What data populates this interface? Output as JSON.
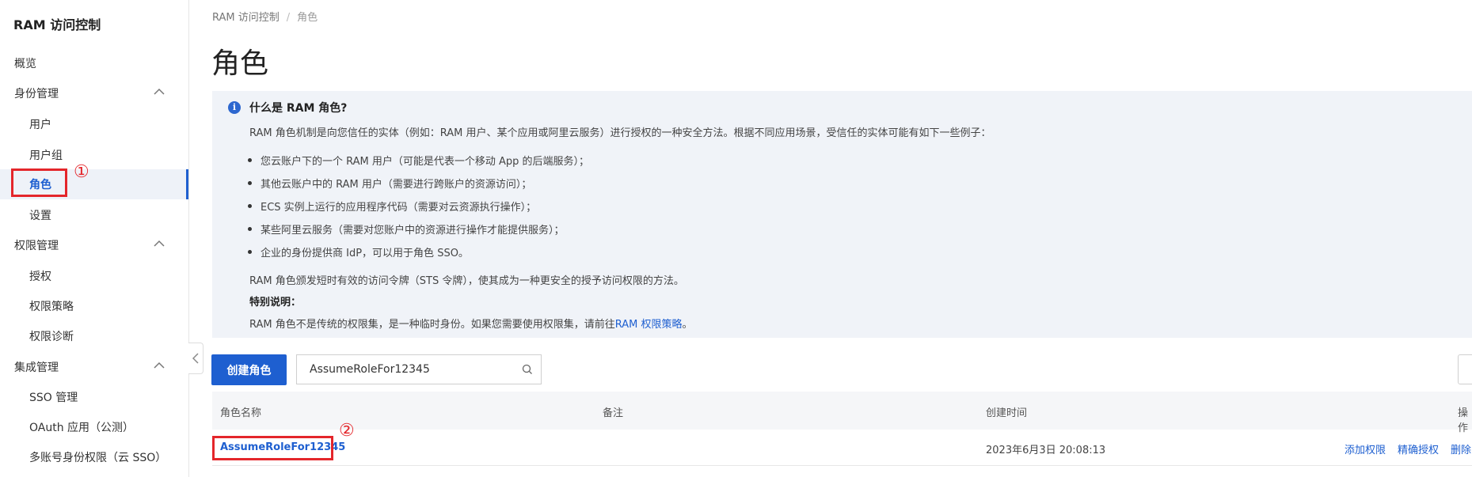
{
  "sidebar": {
    "app_title": "RAM 访问控制",
    "items": [
      {
        "label": "概览"
      },
      {
        "label": "身份管理"
      },
      {
        "label": "用户"
      },
      {
        "label": "用户组"
      },
      {
        "label": "角色"
      },
      {
        "label": "设置"
      },
      {
        "label": "权限管理"
      },
      {
        "label": "授权"
      },
      {
        "label": "权限策略"
      },
      {
        "label": "权限诊断"
      },
      {
        "label": "集成管理"
      },
      {
        "label": "SSO 管理"
      },
      {
        "label": "OAuth 应用（公测）"
      },
      {
        "label": "多账号身份权限（云 SSO）"
      }
    ]
  },
  "annotations": {
    "marker_1": "①",
    "marker_2": "②"
  },
  "breadcrumb": {
    "root": "RAM 访问控制",
    "separator": "/",
    "current": "角色"
  },
  "page_title": "角色",
  "info": {
    "title": "什么是 RAM 角色?",
    "intro": "RAM 角色机制是向您信任的实体（例如：RAM 用户、某个应用或阿里云服务）进行授权的一种安全方法。根据不同应用场景，受信任的实体可能有如下一些例子：",
    "bullets": [
      "您云账户下的一个 RAM 用户（可能是代表一个移动 App 的后端服务）；",
      "其他云账户中的 RAM 用户（需要进行跨账户的资源访问）；",
      "ECS 实例上运行的应用程序代码（需要对云资源执行操作）；",
      "某些阿里云服务（需要对您账户中的资源进行操作才能提供服务）；",
      "企业的身份提供商 IdP，可以用于角色 SSO。"
    ],
    "sts_note": "RAM 角色颁发短时有效的访问令牌（STS 令牌），使其成为一种更安全的授予访问权限的方法。",
    "special_title": "特别说明：",
    "special_text": "RAM 角色不是传统的权限集，是一种临时身份。如果您需要使用权限集，请前往",
    "special_link": "RAM 权限策略",
    "special_end": "。"
  },
  "toolbar": {
    "create_label": "创建角色",
    "search_value": "AssumeRoleFor12345"
  },
  "table": {
    "headers": [
      "角色名称",
      "备注",
      "创建时间",
      "操作"
    ],
    "rows": [
      {
        "name": "AssumeRoleFor12345",
        "note": "",
        "created": "2023年6月3日 20:08:13",
        "ops": [
          "添加权限",
          "精确授权",
          "删除"
        ]
      }
    ]
  },
  "colors": {
    "accent": "#1e5fd0",
    "highlight": "#e4262b",
    "info_bg": "#f0f3f8"
  }
}
